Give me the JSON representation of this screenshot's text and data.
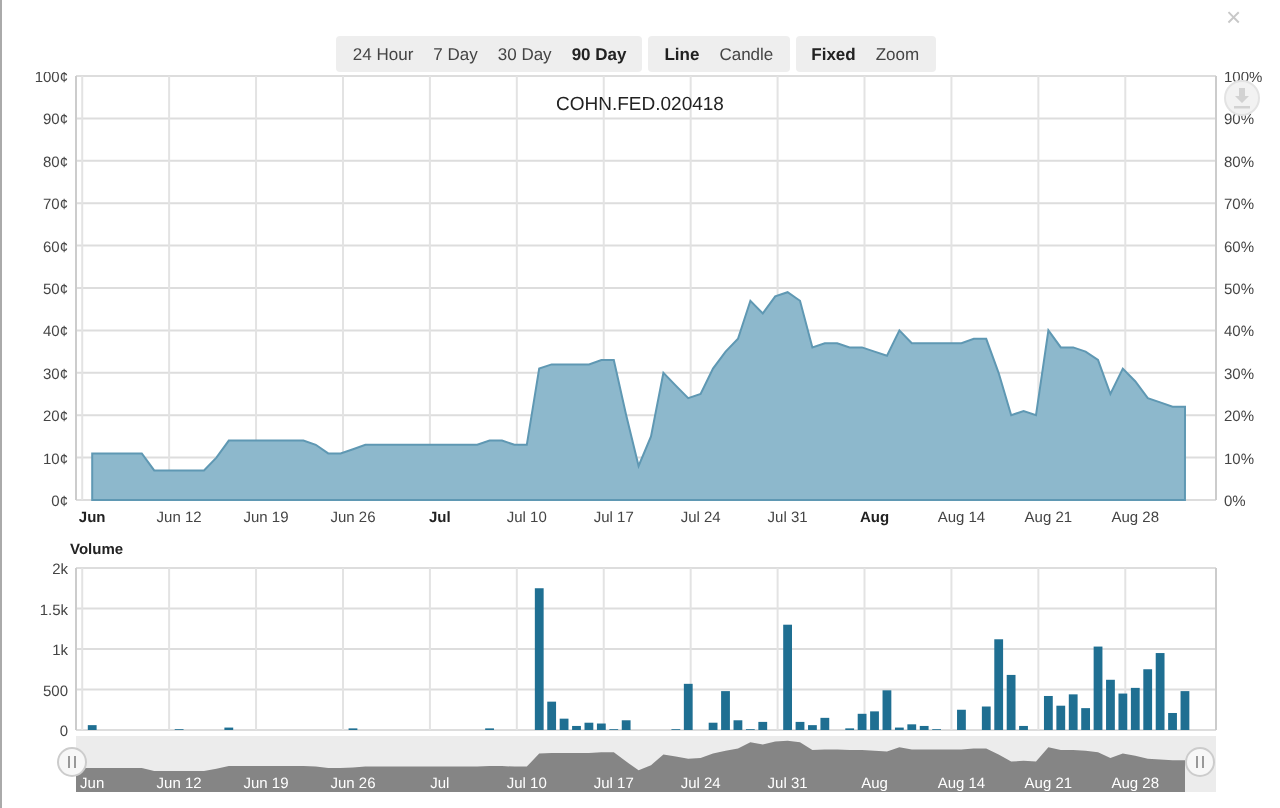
{
  "close_symbol": "×",
  "toolbar": [
    {
      "buttons": [
        {
          "label": "24 Hour",
          "selected": false
        },
        {
          "label": "7 Day",
          "selected": false
        },
        {
          "label": "30 Day",
          "selected": false
        },
        {
          "label": "90 Day",
          "selected": true
        }
      ]
    },
    {
      "buttons": [
        {
          "label": "Line",
          "selected": true
        },
        {
          "label": "Candle",
          "selected": false
        }
      ]
    },
    {
      "buttons": [
        {
          "label": "Fixed",
          "selected": true
        },
        {
          "label": "Zoom",
          "selected": false
        }
      ]
    }
  ],
  "price_chart": {
    "right_axis_labels": [
      "100%",
      "90%",
      "80%",
      "70%",
      "60%",
      "50%",
      "40%",
      "30%",
      "20%",
      "10%",
      "0%"
    ],
    "chart_data": {
      "type": "area",
      "title": "COHN.FED.020418",
      "grid": true,
      "ylim": [
        0,
        100
      ],
      "categories": [
        "Jun",
        null,
        null,
        null,
        null,
        null,
        null,
        "Jun 12",
        null,
        null,
        null,
        null,
        null,
        null,
        "Jun 19",
        null,
        null,
        null,
        null,
        null,
        null,
        "Jun 26",
        null,
        null,
        null,
        null,
        null,
        null,
        "Jul",
        null,
        null,
        null,
        null,
        null,
        null,
        "Jul 10",
        null,
        null,
        null,
        null,
        null,
        null,
        "Jul 17",
        null,
        null,
        null,
        null,
        null,
        null,
        "Jul 24",
        null,
        null,
        null,
        null,
        null,
        null,
        "Jul 31",
        null,
        null,
        null,
        null,
        null,
        null,
        "Aug",
        null,
        null,
        null,
        null,
        null,
        null,
        "Aug 14",
        null,
        null,
        null,
        null,
        null,
        null,
        "Aug 21",
        null,
        null,
        null,
        null,
        null,
        null,
        "Aug 28",
        null,
        null,
        null,
        null,
        null,
        null
      ],
      "values": [
        11,
        11,
        11,
        11,
        11,
        7,
        7,
        7,
        7,
        7,
        10,
        14,
        14,
        14,
        14,
        14,
        14,
        14,
        13,
        11,
        11,
        12,
        13,
        13,
        13,
        13,
        13,
        13,
        13,
        13,
        13,
        13,
        14,
        14,
        13,
        13,
        31,
        32,
        32,
        32,
        32,
        33,
        33,
        20,
        8,
        15,
        30,
        27,
        24,
        25,
        31,
        35,
        38,
        47,
        44,
        48,
        49,
        47,
        36,
        37,
        37,
        36,
        36,
        35,
        34,
        40,
        37,
        37,
        37,
        37,
        37,
        38,
        38,
        30,
        20,
        21,
        20,
        40,
        36,
        36,
        35,
        33,
        25,
        31,
        28,
        24,
        23,
        22,
        22,
        null,
        null
      ],
      "yticks": [
        {
          "value": 0,
          "label": "0¢"
        },
        {
          "value": 10,
          "label": "10¢"
        },
        {
          "value": 20,
          "label": "20¢"
        },
        {
          "value": 30,
          "label": "30¢"
        },
        {
          "value": 40,
          "label": "40¢"
        },
        {
          "value": 50,
          "label": "50¢"
        },
        {
          "value": 60,
          "label": "60¢"
        },
        {
          "value": 70,
          "label": "70¢"
        },
        {
          "value": 80,
          "label": "80¢"
        },
        {
          "value": 90,
          "label": "90¢"
        },
        {
          "value": 100,
          "label": "100¢"
        }
      ]
    }
  },
  "volume_chart": {
    "chart_data": {
      "type": "bar",
      "title": "Volume",
      "grid": true,
      "ylim": [
        0,
        2000
      ],
      "values": [
        60,
        0,
        0,
        0,
        0,
        0,
        0,
        10,
        0,
        0,
        0,
        30,
        0,
        0,
        0,
        0,
        0,
        0,
        0,
        0,
        0,
        20,
        0,
        0,
        0,
        0,
        0,
        0,
        0,
        0,
        0,
        0,
        20,
        0,
        0,
        0,
        1750,
        350,
        140,
        50,
        90,
        80,
        10,
        120,
        0,
        0,
        0,
        10,
        570,
        0,
        90,
        480,
        120,
        10,
        100,
        0,
        1300,
        100,
        60,
        150,
        0,
        20,
        200,
        230,
        490,
        30,
        70,
        50,
        10,
        0,
        250,
        0,
        290,
        1120,
        680,
        50,
        0,
        420,
        300,
        440,
        270,
        1030,
        620,
        450,
        520,
        750,
        950,
        210,
        480,
        0,
        0
      ],
      "yticks": [
        {
          "value": 0,
          "label": "0"
        },
        {
          "value": 500,
          "label": "500"
        },
        {
          "value": 1000,
          "label": "1k"
        },
        {
          "value": 1500,
          "label": "1.5k"
        },
        {
          "value": 2000,
          "label": "2k"
        }
      ]
    }
  },
  "navigator": {
    "labels": [
      "Jun",
      "Jun 12",
      "Jun 19",
      "Jun 26",
      "Jul",
      "Jul 10",
      "Jul 17",
      "Jul 24",
      "Jul 31",
      "Aug",
      "Aug 14",
      "Aug 21",
      "Aug 28"
    ]
  }
}
